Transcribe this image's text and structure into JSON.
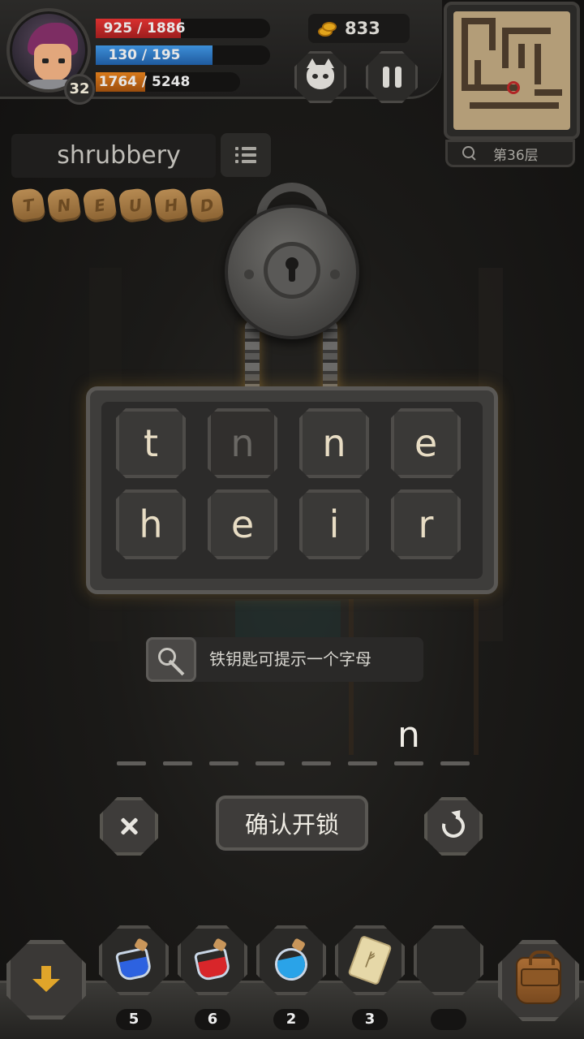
{
  "player": {
    "level": "32",
    "hp_text": "925 / 1886",
    "hp_fraction": 0.49,
    "mp_text": "130 / 195",
    "mp_fraction": 0.67,
    "xp_text": "1764 / 5248",
    "xp_fraction": 0.34
  },
  "currency": {
    "gold": "833",
    "icon": "coin-icon"
  },
  "top_buttons": {
    "pet_icon": "pet-icon",
    "pause_icon": "pause-icon"
  },
  "minimap": {
    "floor_label": "第36层"
  },
  "word": {
    "title": "shrubbery"
  },
  "runes": [
    "T",
    "N",
    "E",
    "U",
    "H",
    "D"
  ],
  "letter_tiles": [
    {
      "letter": "t",
      "used": false
    },
    {
      "letter": "n",
      "used": true
    },
    {
      "letter": "n",
      "used": false
    },
    {
      "letter": "e",
      "used": false
    },
    {
      "letter": "h",
      "used": false
    },
    {
      "letter": "e",
      "used": false
    },
    {
      "letter": "i",
      "used": false
    },
    {
      "letter": "r",
      "used": false
    }
  ],
  "hint": {
    "text": "铁钥匙可提示一个字母",
    "icon": "key-icon"
  },
  "answer_slots": [
    "",
    "",
    "",
    "",
    "",
    "",
    "n",
    ""
  ],
  "actions": {
    "confirm_label": "确认开锁",
    "clear_icon": "close-icon",
    "reset_icon": "reset-icon"
  },
  "inventory": [
    {
      "name": "blue-potion",
      "count": "5"
    },
    {
      "name": "red-potion",
      "count": "6"
    },
    {
      "name": "round-blue-potion",
      "count": "2"
    },
    {
      "name": "scroll",
      "count": "3"
    },
    {
      "name": "empty",
      "count": ""
    }
  ],
  "colors": {
    "hp": "#d9302f",
    "mp": "#3d8fd8",
    "xp": "#d87a1b",
    "gold": "#e3a51c"
  }
}
